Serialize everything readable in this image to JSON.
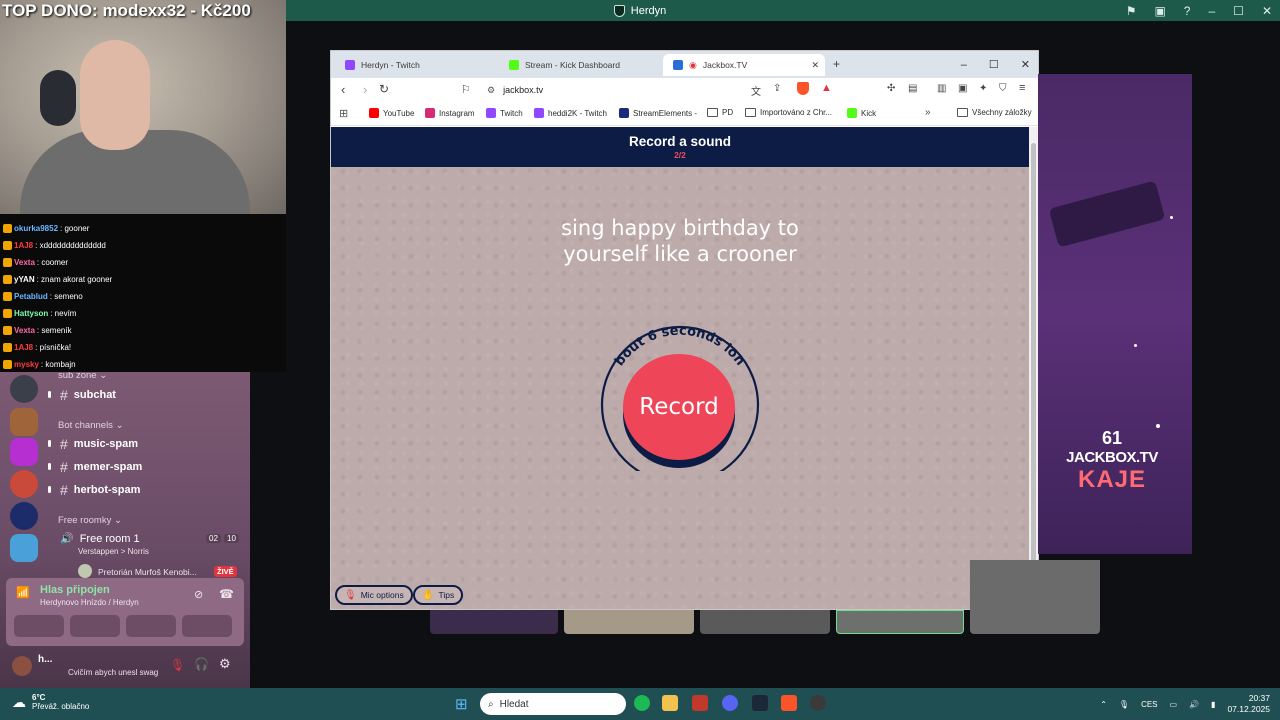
{
  "discord": {
    "window_title": "Herdyn",
    "categories": {
      "sub_zone": "sub zone",
      "bot_channels": "Bot channels",
      "free_roomky": "Free roomky"
    },
    "channels": {
      "subchat": "subchat",
      "music_spam": "music-spam",
      "memer_spam": "memer-spam",
      "herbot_spam": "herbot-spam"
    },
    "voice_room": {
      "name": "Free room 1",
      "sub": "Verstappen > Norris",
      "count_a": "02",
      "count_b": "10",
      "member": "Pretorián Murfoš Kenobi...",
      "live_badge": "ŽIVĚ"
    },
    "voice_panel": {
      "status": "Hlas připojen",
      "location": "Herdynovo Hnízdo / Herdyn"
    },
    "user_panel": {
      "name": "h...",
      "status": "Cvičím abych unesl swag"
    }
  },
  "stream_overlay": {
    "top_donor": "TOP DONO: modexx32 - Kč200",
    "chat": [
      {
        "user": "okurka9852",
        "msg": "gooner",
        "color": "#6ab6ff"
      },
      {
        "user": "1AJ8",
        "msg": "xdddddddddddddd",
        "color": "#ff3b3b"
      },
      {
        "user": "Vexta",
        "msg": "coomer",
        "color": "#ff6aa8"
      },
      {
        "user": "yYAN",
        "msg": "znam akorat gooner",
        "color": "#ffffff"
      },
      {
        "user": "Petablud",
        "msg": "semeno",
        "color": "#6ab6ff"
      },
      {
        "user": "Hattyson",
        "msg": "nevím",
        "color": "#7dffb2"
      },
      {
        "user": "Vexta",
        "msg": "semeník",
        "color": "#ff6aa8"
      },
      {
        "user": "1AJ8",
        "msg": "písnička!",
        "color": "#ff3b3b"
      },
      {
        "user": "mysky",
        "msg": "kombajn",
        "color": "#ff3b3b"
      }
    ]
  },
  "browser": {
    "tabs": [
      {
        "label": "Herdyn - Twitch",
        "color": "#9146ff"
      },
      {
        "label": "Stream - Kick Dashboard",
        "color": "#53fc18"
      },
      {
        "label": "Jackbox.TV",
        "color": "#2a6dd9"
      }
    ],
    "url": "jackbox.tv",
    "bookmarks": [
      "YouTube",
      "Instagram",
      "Twitch",
      "heddi2K - Twitch",
      "StreamElements -",
      "PD",
      "Importováno z Chr...",
      "Kick"
    ],
    "all_bookmarks": "Všechny záložky"
  },
  "jackbox": {
    "title": "Record a sound",
    "progress": "2/2",
    "prompt_line1": "sing happy birthday to",
    "prompt_line2": "yourself like a crooner",
    "duration_label": "about 6 seconds long",
    "record_label": "Record",
    "mic_options": "Mic options",
    "tips": "Tips"
  },
  "stream_right": {
    "num": "61",
    "site": "JACKBOX.TV",
    "name": "KAJE"
  },
  "taskbar": {
    "weather_temp": "6°C",
    "weather_desc": "Převáž. oblačno",
    "search_placeholder": "Hledat",
    "lang": "CES",
    "time": "20:37",
    "date": "07.12.2025"
  }
}
